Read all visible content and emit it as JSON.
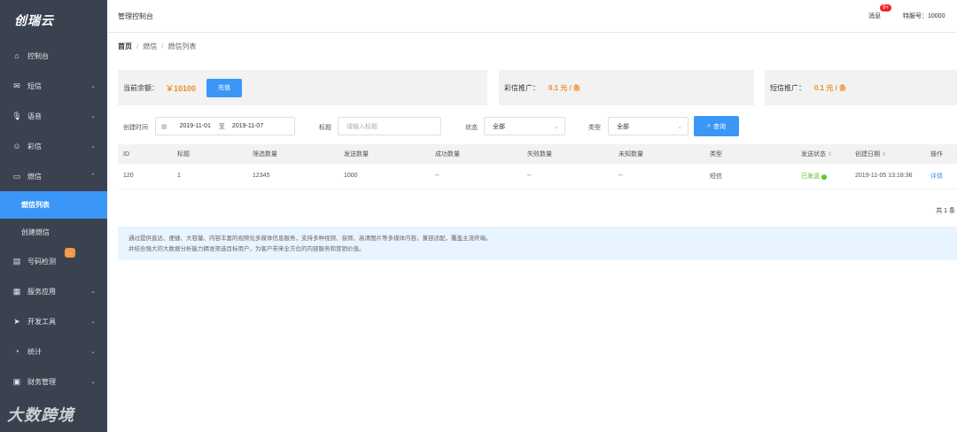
{
  "app": {
    "logo": "创瑞云"
  },
  "sidebar": {
    "items": [
      {
        "label": "控制台",
        "icon": "home-icon"
      },
      {
        "label": "短信",
        "icon": "mail-icon"
      },
      {
        "label": "语音",
        "icon": "microphone-icon"
      },
      {
        "label": "彩信",
        "icon": "smile-icon"
      },
      {
        "label": "燃信",
        "icon": "chat-icon"
      },
      {
        "label": "号码检测",
        "icon": "box-icon"
      },
      {
        "label": "服务应用",
        "icon": "grid-icon"
      },
      {
        "label": "开发工具",
        "icon": "send-icon"
      },
      {
        "label": "统计",
        "icon": "pie-icon"
      },
      {
        "label": "财务管理",
        "icon": "wallet-icon"
      }
    ],
    "sub_items": [
      {
        "label": "燃信列表"
      },
      {
        "label": "创建燃信"
      }
    ],
    "watermark": "大数跨境"
  },
  "topbar": {
    "title": "管理控制台",
    "messages_label": "消息",
    "messages_badge": "9+",
    "account": "特服号：10000"
  },
  "breadcrumb": [
    "首页",
    "燃信",
    "燃信列表"
  ],
  "summary": {
    "balance_label": "当前余额：",
    "balance_value": "￥10100",
    "recharge_button": "充值",
    "mms_label": "彩信推广：",
    "mms_price": "0.1 元 / 条",
    "sms_label": "短信推广：",
    "sms_price": "0.1 元 / 条"
  },
  "filters": {
    "created_label": "创建时间",
    "date_from": "2019-11-01",
    "date_to_sep": "至",
    "date_to": "2019-11-07",
    "title_label": "标题",
    "title_placeholder": "请输入标题",
    "status_label": "状态",
    "status_value": "全部",
    "type_label": "类型",
    "type_value": "全部",
    "search_button": "查询"
  },
  "table": {
    "columns": [
      "ID",
      "标题",
      "筛选数量",
      "发送数量",
      "成功数量",
      "失败数量",
      "未知数量",
      "类型",
      "发送状态",
      "创建日期",
      "操作"
    ],
    "rows": [
      [
        "120",
        "1",
        "12345",
        "1000",
        "--",
        "--",
        "--",
        "短信",
        "已发送",
        "2019-11-05 13:18:36",
        "详情"
      ]
    ],
    "total": "共 1 条"
  },
  "note": {
    "line1": "通过提供直达、便捷、大容量、内容丰富的视频化多媒体信息服务，支持多种视频、音频、高清图片等多媒体内容，兼容适配，覆盖主流终端。",
    "line2": "并结合强大的大数据分析能力精准筛选目标用户，为客户带来全方位的内容服务和营销价值。"
  }
}
